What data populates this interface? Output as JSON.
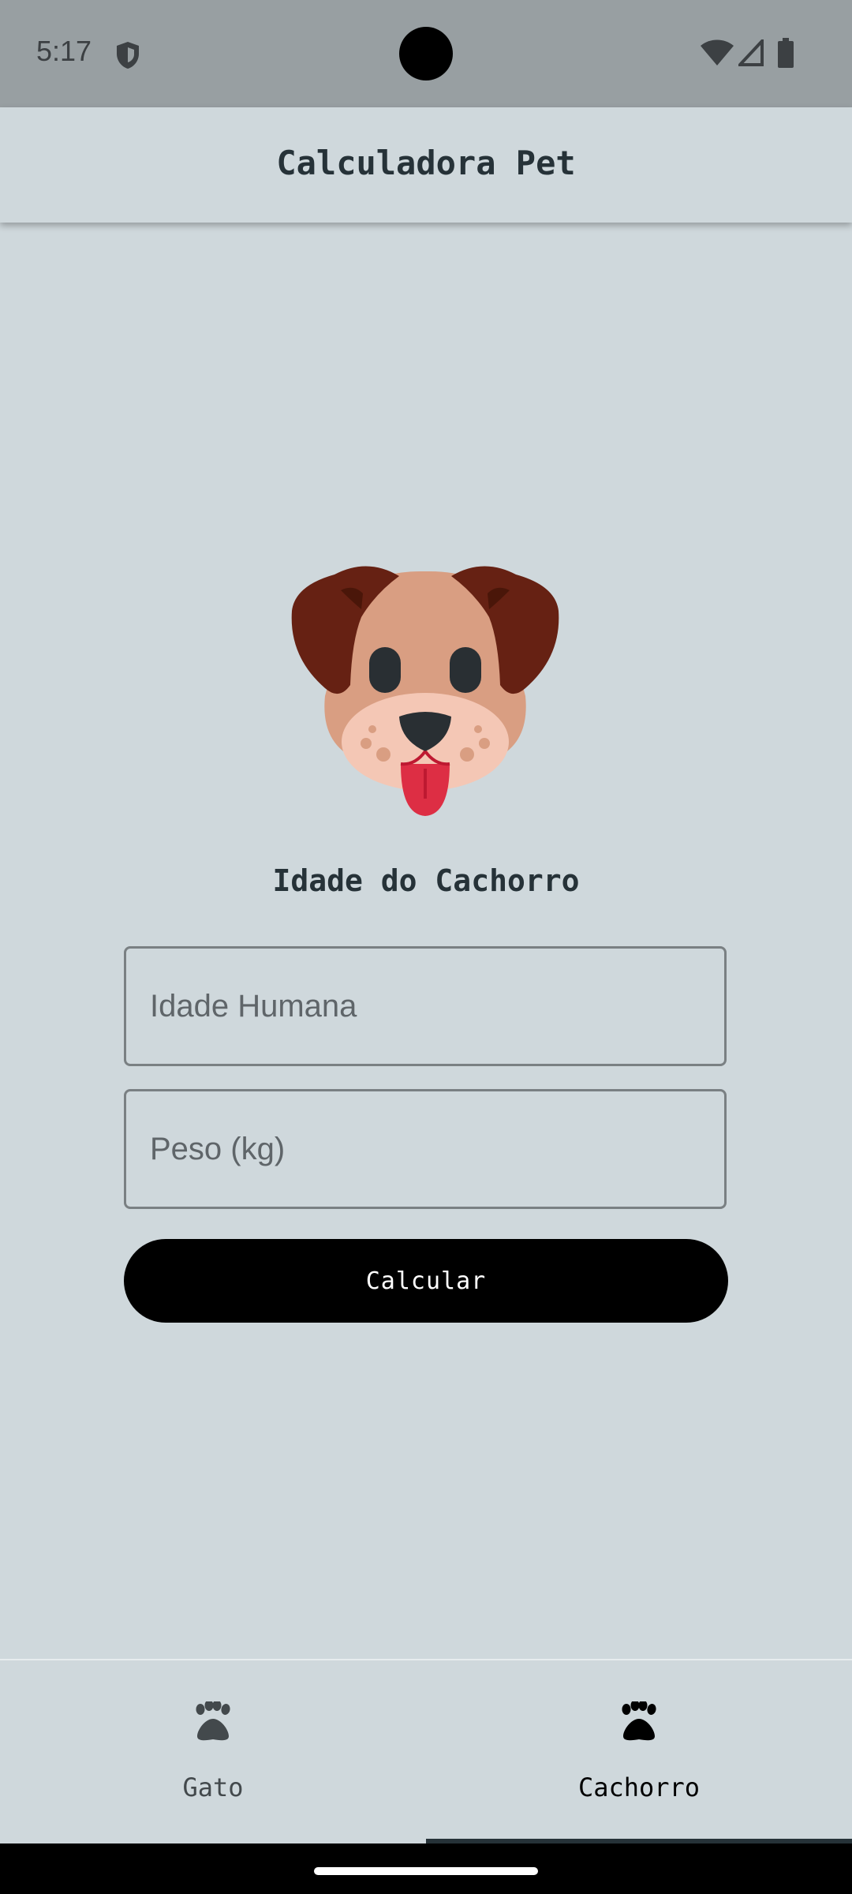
{
  "status_bar": {
    "time": "5:17",
    "icons": [
      "shield-icon",
      "wifi-icon",
      "signal-icon",
      "battery-icon"
    ]
  },
  "app_bar": {
    "title": "Calculadora Pet"
  },
  "main": {
    "illustration": "dog-face",
    "section_title": "Idade do Cachorro",
    "age_field": {
      "value": "",
      "placeholder": "Idade Humana"
    },
    "weight_field": {
      "value": "",
      "placeholder": "Peso (kg)"
    },
    "calculate_label": "Calcular"
  },
  "bottom_nav": {
    "tabs": [
      {
        "label": "Gato",
        "icon": "paw-icon",
        "selected": false
      },
      {
        "label": "Cachorro",
        "icon": "paw-icon",
        "selected": true
      }
    ]
  },
  "colors": {
    "background": "#cfd8dc",
    "status_bar": "#989fa2",
    "primary_text": "#263238",
    "button": "#000000",
    "button_text": "#ffffff"
  }
}
